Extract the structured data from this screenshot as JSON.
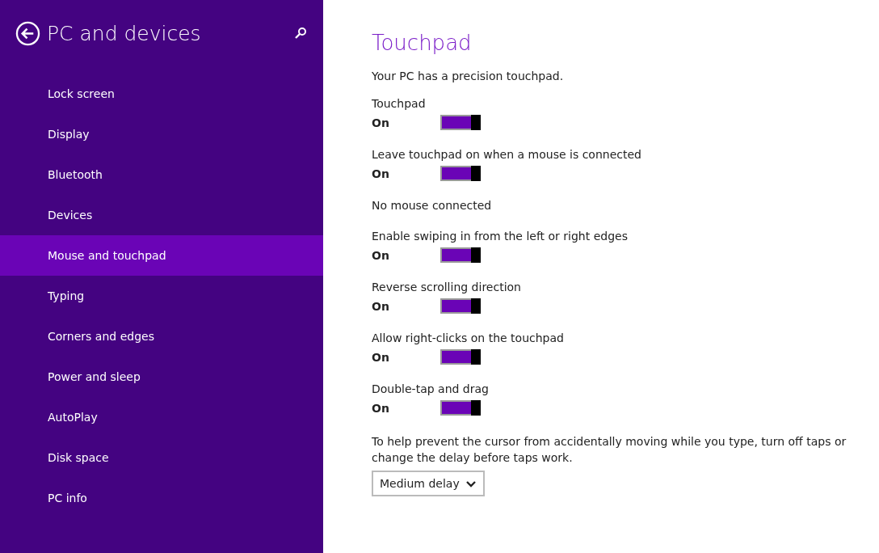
{
  "sidebar": {
    "title": "PC and devices",
    "items": [
      {
        "label": "Lock screen",
        "selected": false
      },
      {
        "label": "Display",
        "selected": false
      },
      {
        "label": "Bluetooth",
        "selected": false
      },
      {
        "label": "Devices",
        "selected": false
      },
      {
        "label": "Mouse and touchpad",
        "selected": true
      },
      {
        "label": "Typing",
        "selected": false
      },
      {
        "label": "Corners and edges",
        "selected": false
      },
      {
        "label": "Power and sleep",
        "selected": false
      },
      {
        "label": "AutoPlay",
        "selected": false
      },
      {
        "label": "Disk space",
        "selected": false
      },
      {
        "label": "PC info",
        "selected": false
      }
    ]
  },
  "content": {
    "title": "Touchpad",
    "intro": "Your PC has a precision touchpad.",
    "settings": [
      {
        "kind": "toggle",
        "label": "Touchpad",
        "state": "On",
        "on": true
      },
      {
        "kind": "toggle",
        "label": "Leave touchpad on when a mouse is connected",
        "state": "On",
        "on": true
      },
      {
        "kind": "text",
        "label": "No mouse connected"
      },
      {
        "kind": "toggle",
        "label": "Enable swiping in from the left or right edges",
        "state": "On",
        "on": true
      },
      {
        "kind": "toggle",
        "label": "Reverse scrolling direction",
        "state": "On",
        "on": true
      },
      {
        "kind": "toggle",
        "label": "Allow right-clicks on the touchpad",
        "state": "On",
        "on": true
      },
      {
        "kind": "toggle",
        "label": "Double-tap and drag",
        "state": "On",
        "on": true
      }
    ],
    "delay_note": "To help prevent the cursor from accidentally moving while you type, turn off taps or change the delay before taps work.",
    "delay_select": {
      "value": "Medium delay"
    }
  }
}
